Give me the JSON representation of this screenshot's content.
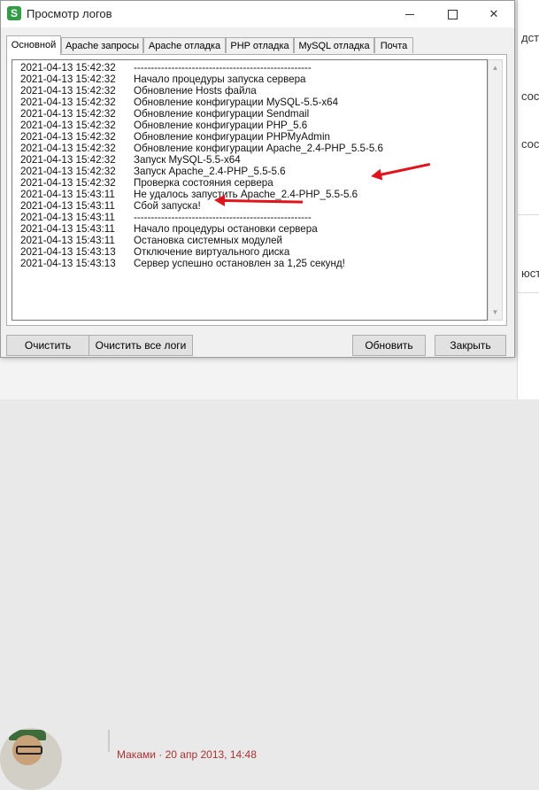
{
  "window": {
    "title": "Просмотр логов",
    "app_icon_letter": "S"
  },
  "tabs": [
    {
      "label": "Основной",
      "active": true
    },
    {
      "label": "Apache запросы",
      "active": false
    },
    {
      "label": "Apache отладка",
      "active": false
    },
    {
      "label": "PHP отладка",
      "active": false
    },
    {
      "label": "MySQL отладка",
      "active": false
    },
    {
      "label": "Почта",
      "active": false
    }
  ],
  "log": [
    {
      "ts": "2021-04-13 15:42:32",
      "msg": "----------------------------------------------------"
    },
    {
      "ts": "2021-04-13 15:42:32",
      "msg": "Начало процедуры запуска сервера"
    },
    {
      "ts": "2021-04-13 15:42:32",
      "msg": "Обновление Hosts файла"
    },
    {
      "ts": "2021-04-13 15:42:32",
      "msg": "Обновление конфигурации MySQL-5.5-x64"
    },
    {
      "ts": "2021-04-13 15:42:32",
      "msg": "Обновление конфигурации Sendmail"
    },
    {
      "ts": "2021-04-13 15:42:32",
      "msg": "Обновление конфигурации PHP_5.6"
    },
    {
      "ts": "2021-04-13 15:42:32",
      "msg": "Обновление конфигурации PHPMyAdmin"
    },
    {
      "ts": "2021-04-13 15:42:32",
      "msg": "Обновление конфигурации Apache_2.4-PHP_5.5-5.6"
    },
    {
      "ts": "2021-04-13 15:42:32",
      "msg": "Запуск MySQL-5.5-x64"
    },
    {
      "ts": "2021-04-13 15:42:32",
      "msg": "Запуск Apache_2.4-PHP_5.5-5.6"
    },
    {
      "ts": "2021-04-13 15:42:32",
      "msg": "Проверка состояния сервера"
    },
    {
      "ts": "2021-04-13 15:43:11",
      "msg": "Не удалось запустить Apache_2.4-PHP_5.5-5.6"
    },
    {
      "ts": "2021-04-13 15:43:11",
      "msg": "Сбой запуска!"
    },
    {
      "ts": "2021-04-13 15:43:11",
      "msg": "----------------------------------------------------"
    },
    {
      "ts": "2021-04-13 15:43:11",
      "msg": "Начало процедуры остановки сервера"
    },
    {
      "ts": "2021-04-13 15:43:11",
      "msg": "Остановка системных модулей"
    },
    {
      "ts": "2021-04-13 15:43:13",
      "msg": "Отключение виртуального диска"
    },
    {
      "ts": "2021-04-13 15:43:13",
      "msg": "Сервер успешно остановлен за 1,25 секунд!"
    }
  ],
  "buttons": {
    "clear": "Очистить",
    "clear_all": "Очистить все логи",
    "refresh": "Обновить",
    "close": "Закрыть"
  },
  "background": {
    "fragments": [
      "дсту",
      "состоя",
      "состоя",
      "юст"
    ],
    "comment_author": "Маками · 20 апр 2013, 14:48"
  },
  "colors": {
    "annotation_arrow": "#e0141a",
    "app_icon": "#2f9e44"
  },
  "icons": [
    "app-logo-icon",
    "minimize-icon",
    "maximize-icon",
    "close-icon",
    "scroll-up-icon",
    "scroll-down-icon"
  ]
}
